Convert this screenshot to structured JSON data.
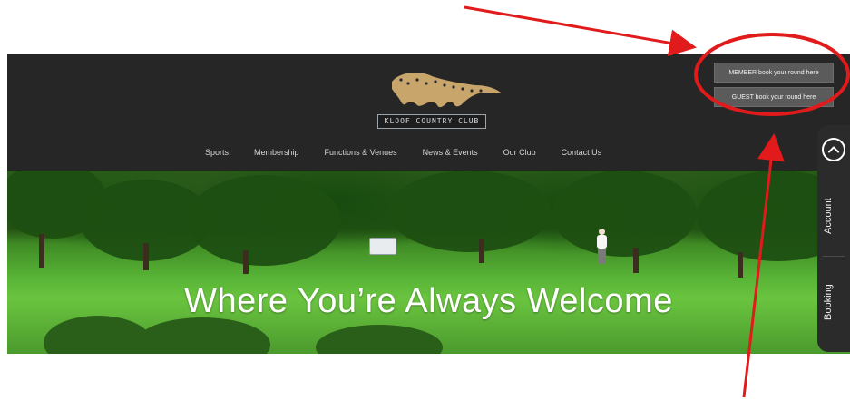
{
  "header": {
    "logo_text": "KLOOF COUNTRY CLUB",
    "member_button": "MEMBER book your round here",
    "guest_button": "GUEST book your round here"
  },
  "nav": {
    "items": [
      {
        "label": "Sports"
      },
      {
        "label": "Membership"
      },
      {
        "label": "Functions & Venues"
      },
      {
        "label": "News & Events"
      },
      {
        "label": "Our Club"
      },
      {
        "label": "Contact Us"
      }
    ]
  },
  "hero": {
    "title": "Where You’re Always Welcome"
  },
  "side_panel": {
    "up_icon": "chevron-up-icon",
    "account_label": "Account",
    "booking_label": "Booking"
  },
  "annotations": {
    "color": "#e11b1b"
  }
}
